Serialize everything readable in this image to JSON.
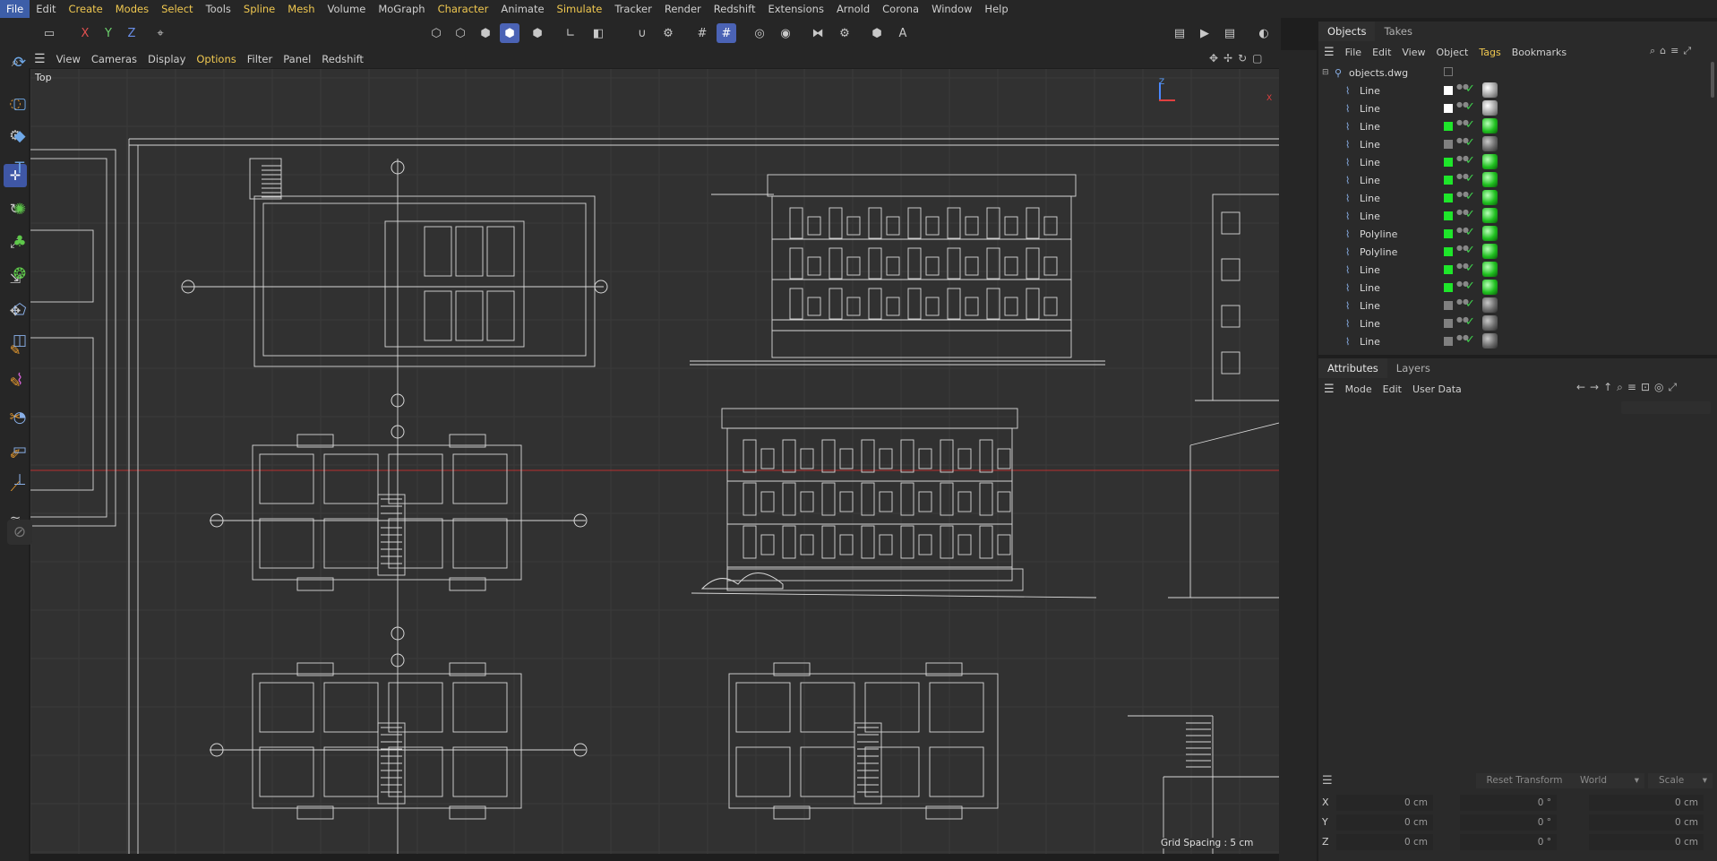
{
  "menubar": {
    "items": [
      "File",
      "Edit",
      "Create",
      "Modes",
      "Select",
      "Tools",
      "Spline",
      "Mesh",
      "Volume",
      "MoGraph",
      "Character",
      "Animate",
      "Simulate",
      "Tracker",
      "Render",
      "Redshift",
      "Extensions",
      "Arnold",
      "Corona",
      "Window",
      "Help"
    ],
    "highlighted": [
      "Create",
      "Modes",
      "Select",
      "Spline",
      "Mesh",
      "Character",
      "Simulate"
    ]
  },
  "toolbar": {
    "axis_x": "X",
    "axis_y": "Y",
    "axis_z": "Z"
  },
  "viewport": {
    "menu": [
      "View",
      "Cameras",
      "Display",
      "Options",
      "Filter",
      "Panel",
      "Redshift"
    ],
    "menu_highlighted": "Options",
    "view_label": "Top",
    "grid_spacing": "Grid Spacing : 5 cm",
    "gizmo_y": "Z",
    "gizmo_x": "X"
  },
  "objects_panel": {
    "tabs": [
      "Objects",
      "Takes"
    ],
    "menu": [
      "File",
      "Edit",
      "View",
      "Object",
      "Tags",
      "Bookmarks"
    ],
    "menu_highlighted": "Tags",
    "root": "objects.dwg",
    "rows": [
      {
        "name": "Line",
        "color": "#ffffff",
        "ball": "white"
      },
      {
        "name": "Line",
        "color": "#ffffff",
        "ball": "white"
      },
      {
        "name": "Line",
        "color": "#1ee62a",
        "ball": "green"
      },
      {
        "name": "Line",
        "color": "#808080",
        "ball": "gray"
      },
      {
        "name": "Line",
        "color": "#1ee62a",
        "ball": "green"
      },
      {
        "name": "Line",
        "color": "#1ee62a",
        "ball": "green"
      },
      {
        "name": "Line",
        "color": "#1ee62a",
        "ball": "green"
      },
      {
        "name": "Line",
        "color": "#1ee62a",
        "ball": "green"
      },
      {
        "name": "Polyline",
        "color": "#1ee62a",
        "ball": "green"
      },
      {
        "name": "Polyline",
        "color": "#1ee62a",
        "ball": "green"
      },
      {
        "name": "Line",
        "color": "#1ee62a",
        "ball": "green"
      },
      {
        "name": "Line",
        "color": "#1ee62a",
        "ball": "green"
      },
      {
        "name": "Line",
        "color": "#808080",
        "ball": "gray"
      },
      {
        "name": "Line",
        "color": "#808080",
        "ball": "gray"
      },
      {
        "name": "Line",
        "color": "#808080",
        "ball": "gray"
      }
    ]
  },
  "attributes_panel": {
    "tabs": [
      "Attributes",
      "Layers"
    ],
    "menu": [
      "Mode",
      "Edit",
      "User Data"
    ]
  },
  "coordinates": {
    "reset_button": "Reset Transform",
    "space": "World",
    "mode": "Scale",
    "rows": [
      {
        "axis": "X",
        "pos": "0 cm",
        "rot": "0 °",
        "scale": "0 cm"
      },
      {
        "axis": "Y",
        "pos": "0 cm",
        "rot": "0 °",
        "scale": "0 cm"
      },
      {
        "axis": "Z",
        "pos": "0 cm",
        "rot": "0 °",
        "scale": "0 cm"
      }
    ]
  },
  "colors": {
    "accent": "#4b63b5",
    "menu_highlight": "#f0c850",
    "viewport_bg": "#313131",
    "drawing_line": "#d8d8d8",
    "horizon_line": "#b83030"
  }
}
